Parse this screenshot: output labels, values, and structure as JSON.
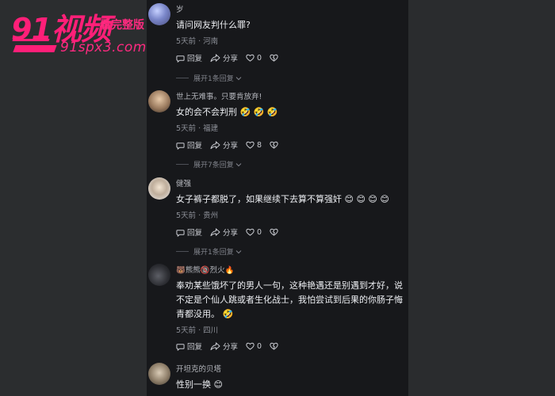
{
  "watermark": {
    "logo": "91视频",
    "tagline": "看完整版",
    "url": "91spx3.com"
  },
  "comments": [
    {
      "user": "岁",
      "text": "请问网友判什么罪?",
      "meta": "5天前 · 河南",
      "reply_label": "回复",
      "share_label": "分享",
      "likes": "0",
      "expand": "展开1条回复"
    },
    {
      "user": "世上无难事。只要肯放弃!",
      "text": "女的会不会判刑 🤣 🤣 🤣",
      "meta": "5天前 · 福建",
      "reply_label": "回复",
      "share_label": "分享",
      "likes": "8",
      "expand": "展开7条回复"
    },
    {
      "user": "健强",
      "text": "女子裤子都脱了，如果继续下去算不算强奸 😊 😊 😊 😊",
      "meta": "5天前 · 贵州",
      "reply_label": "回复",
      "share_label": "分享",
      "likes": "0",
      "expand": "展开1条回复"
    },
    {
      "user": "🐻熊熊🔞烈火🔥",
      "text": "奉劝某些饿坏了的男人一句，这种艳遇还是别遇到才好，说不定是个仙人跳或者生化战士，我怕尝试到后果的你肠子悔青都没用。 🤣",
      "meta": "5天前 · 四川",
      "reply_label": "回复",
      "share_label": "分享",
      "likes": "0"
    },
    {
      "user": "开坦克的贝塔",
      "text": "性别一换 😊"
    }
  ]
}
